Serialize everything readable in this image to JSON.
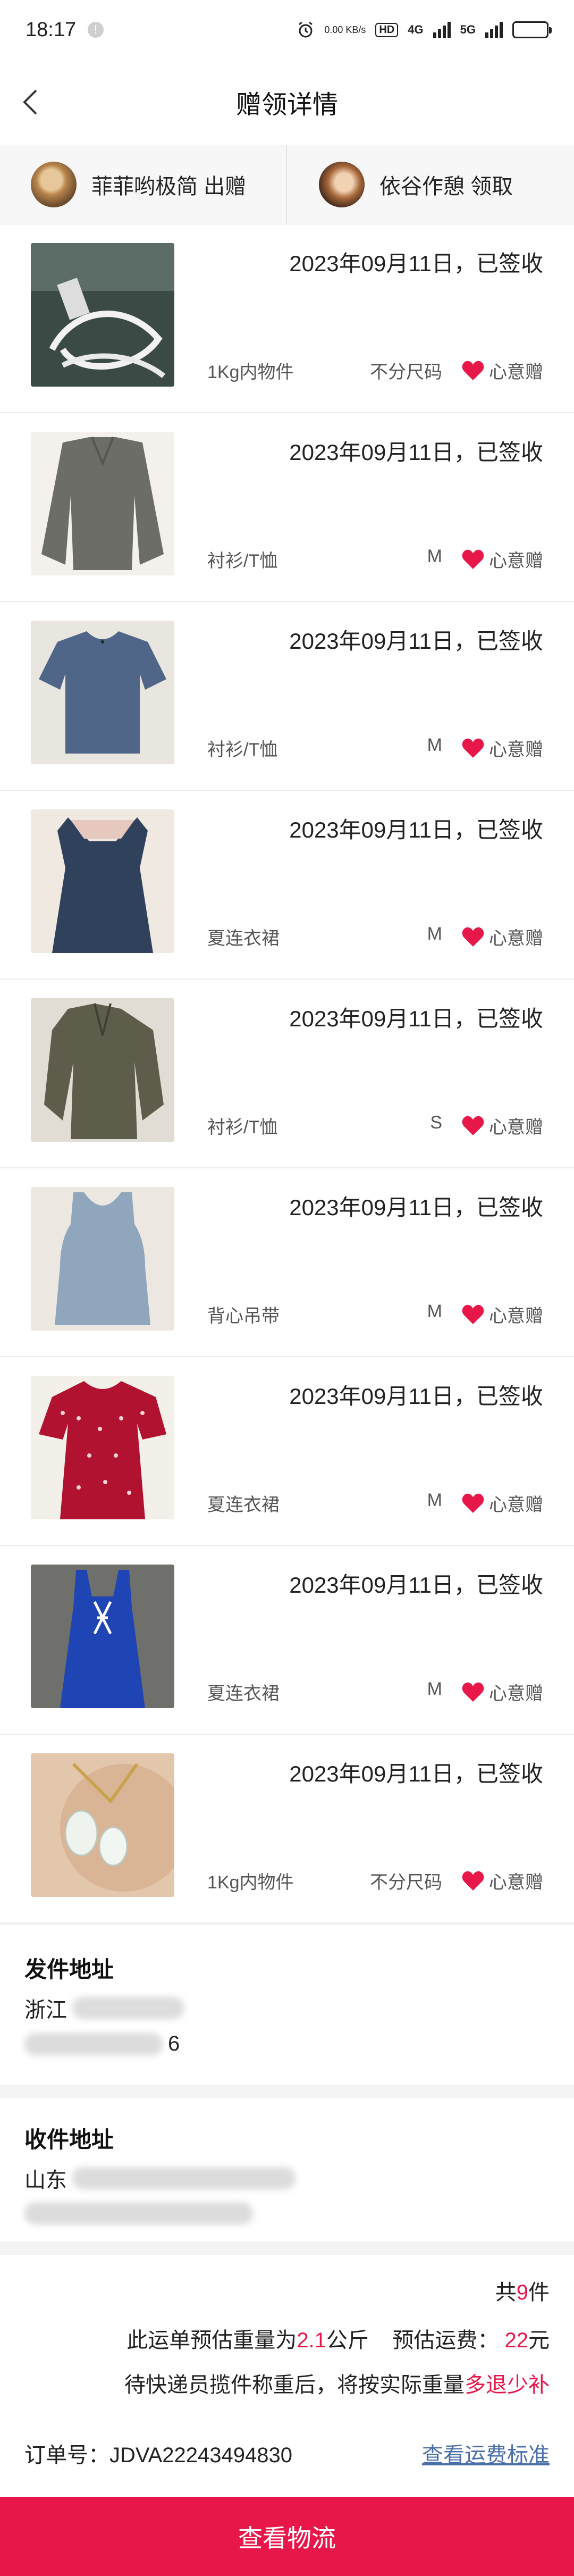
{
  "status_bar": {
    "time": "18:17",
    "net_speed": "0.00 KB/s",
    "hd": "HD",
    "net_4g": "4G",
    "net_5g": "5G"
  },
  "nav": {
    "title": "赠领详情"
  },
  "giver": {
    "name": "菲菲哟极简",
    "action": "出赠"
  },
  "receiver": {
    "name": "依谷作憩",
    "action": "领取"
  },
  "items": [
    {
      "date": "2023年09月11日，已签收",
      "category": "1Kg内物件",
      "size": "不分尺码",
      "gift_label": "心意赠",
      "thumb": "cable"
    },
    {
      "date": "2023年09月11日，已签收",
      "category": "衬衫/T恤",
      "size": "M",
      "gift_label": "心意赠",
      "thumb": "grey-shirt"
    },
    {
      "date": "2023年09月11日，已签收",
      "category": "衬衫/T恤",
      "size": "M",
      "gift_label": "心意赠",
      "thumb": "blue-tee"
    },
    {
      "date": "2023年09月11日，已签收",
      "category": "夏连衣裙",
      "size": "M",
      "gift_label": "心意赠",
      "thumb": "navy-dress"
    },
    {
      "date": "2023年09月11日，已签收",
      "category": "衬衫/T恤",
      "size": "S",
      "gift_label": "心意赠",
      "thumb": "olive-shirt"
    },
    {
      "date": "2023年09月11日，已签收",
      "category": "背心吊带",
      "size": "M",
      "gift_label": "心意赠",
      "thumb": "blue-tank"
    },
    {
      "date": "2023年09月11日，已签收",
      "category": "夏连衣裙",
      "size": "M",
      "gift_label": "心意赠",
      "thumb": "red-dress"
    },
    {
      "date": "2023年09月11日，已签收",
      "category": "夏连衣裙",
      "size": "M",
      "gift_label": "心意赠",
      "thumb": "royal-dress"
    },
    {
      "date": "2023年09月11日，已签收",
      "category": "1Kg内物件",
      "size": "不分尺码",
      "gift_label": "心意赠",
      "thumb": "jade-pendant"
    }
  ],
  "sender_address": {
    "heading": "发件地址",
    "line1": "浙江",
    "line2_tail": "6"
  },
  "receiver_address": {
    "heading": "收件地址",
    "line1": "山东"
  },
  "summary": {
    "count_prefix": "共",
    "count": "9",
    "count_suffix": "件",
    "weight_prefix": "此运单预估重量为",
    "weight": "2.1",
    "weight_unit": "公斤",
    "fee_label": "预估运费：",
    "fee": "22",
    "fee_unit": "元",
    "note_prefix": "待快递员揽件称重后，将按实际重量",
    "note_highlight": "多退少补",
    "order_label": "订单号：",
    "order_no": "JDVA22243494830",
    "fee_standard_link": "查看运费标准"
  },
  "logistics_button": "查看物流",
  "colors": {
    "accent": "#e8174a",
    "link": "#4a6fa8"
  }
}
